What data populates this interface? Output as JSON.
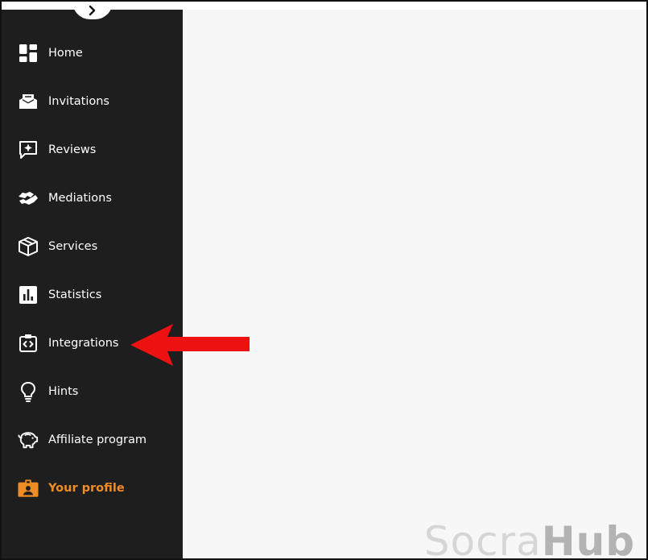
{
  "sidebar": {
    "collapse_icon": "chevron-right-icon",
    "items": [
      {
        "label": "Home",
        "icon": "dashboard-grid-icon"
      },
      {
        "label": "Invitations",
        "icon": "envelope-tray-icon"
      },
      {
        "label": "Reviews",
        "icon": "sparkle-chat-icon"
      },
      {
        "label": "Mediations",
        "icon": "handshake-icon"
      },
      {
        "label": "Services",
        "icon": "box-icon"
      },
      {
        "label": "Statistics",
        "icon": "bar-chart-icon"
      },
      {
        "label": "Integrations",
        "icon": "code-clipboard-icon"
      },
      {
        "label": "Hints",
        "icon": "lightbulb-icon"
      },
      {
        "label": "Affiliate program",
        "icon": "piggy-bank-icon"
      },
      {
        "label": "Your profile",
        "icon": "id-badge-icon",
        "active": true
      }
    ]
  },
  "watermark": {
    "part1": "Socra",
    "part2": "Hub"
  },
  "colors": {
    "sidebar_bg": "#1e1e1e",
    "active": "#f08c24",
    "arrow": "#ee1111",
    "main_bg": "#f7f7f7"
  }
}
